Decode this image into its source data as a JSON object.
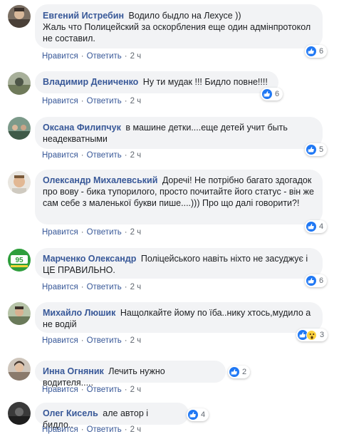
{
  "actions": {
    "like": "Нравится",
    "reply": "Ответить",
    "sep": "·"
  },
  "comments": [
    {
      "author": "Евгений Истребин",
      "text": "Водило быдло на Лехусе ))\nЖаль что Полицейский за оскорбления еще один адмінпротокол не составил.",
      "time": "2 ч",
      "reactions": 6,
      "icons": [
        "like-icon"
      ]
    },
    {
      "author": "Владимир Дениченко",
      "text": "Ну ти мудак !!! Бидло повне!!!!",
      "time": "2 ч",
      "reactions": 6,
      "icons": [
        "like-icon"
      ]
    },
    {
      "author": "Оксана Филипчук",
      "text": "в машине детки....еще детей учит быть неадекватными",
      "time": "2 ч",
      "reactions": 5,
      "icons": [
        "like-icon"
      ]
    },
    {
      "author": "Олександр Михалевський",
      "text": "Дoречі! Не потрібно багато здогадок про вову - бика тупорилого, просто почитайте його статус - він же сам себе з маленької букви пише....))) Про що далі говорити?!",
      "time": "2 ч",
      "reactions": 4,
      "icons": [
        "like-icon"
      ]
    },
    {
      "author": "Марченко Олександр",
      "text": "Поліцейського навіть ніхто не засуджує і ЦЕ ПРАВИЛЬНО.",
      "time": "2 ч",
      "reactions": 6,
      "icons": [
        "like-icon"
      ]
    },
    {
      "author": "Михайло Люшик",
      "text": "Нащолкайте йому по їба..нику хтось,мудило а не водій",
      "time": "2 ч",
      "reactions": 3,
      "icons": [
        "like-icon",
        "wow-icon"
      ]
    },
    {
      "author": "Инна Огняник",
      "text": "Лечить нужно водителя.....",
      "time": "2 ч",
      "reactions": 2,
      "icons": [
        "like-icon"
      ]
    },
    {
      "author": "Олег Кисель",
      "text": "але автор і бидло..",
      "time": "2 ч",
      "reactions": 4,
      "icons": [
        "like-icon"
      ]
    }
  ],
  "colors": {
    "link": "#385898",
    "bubble": "#f2f3f5",
    "like": "#2078f4",
    "meta": "#606770"
  }
}
